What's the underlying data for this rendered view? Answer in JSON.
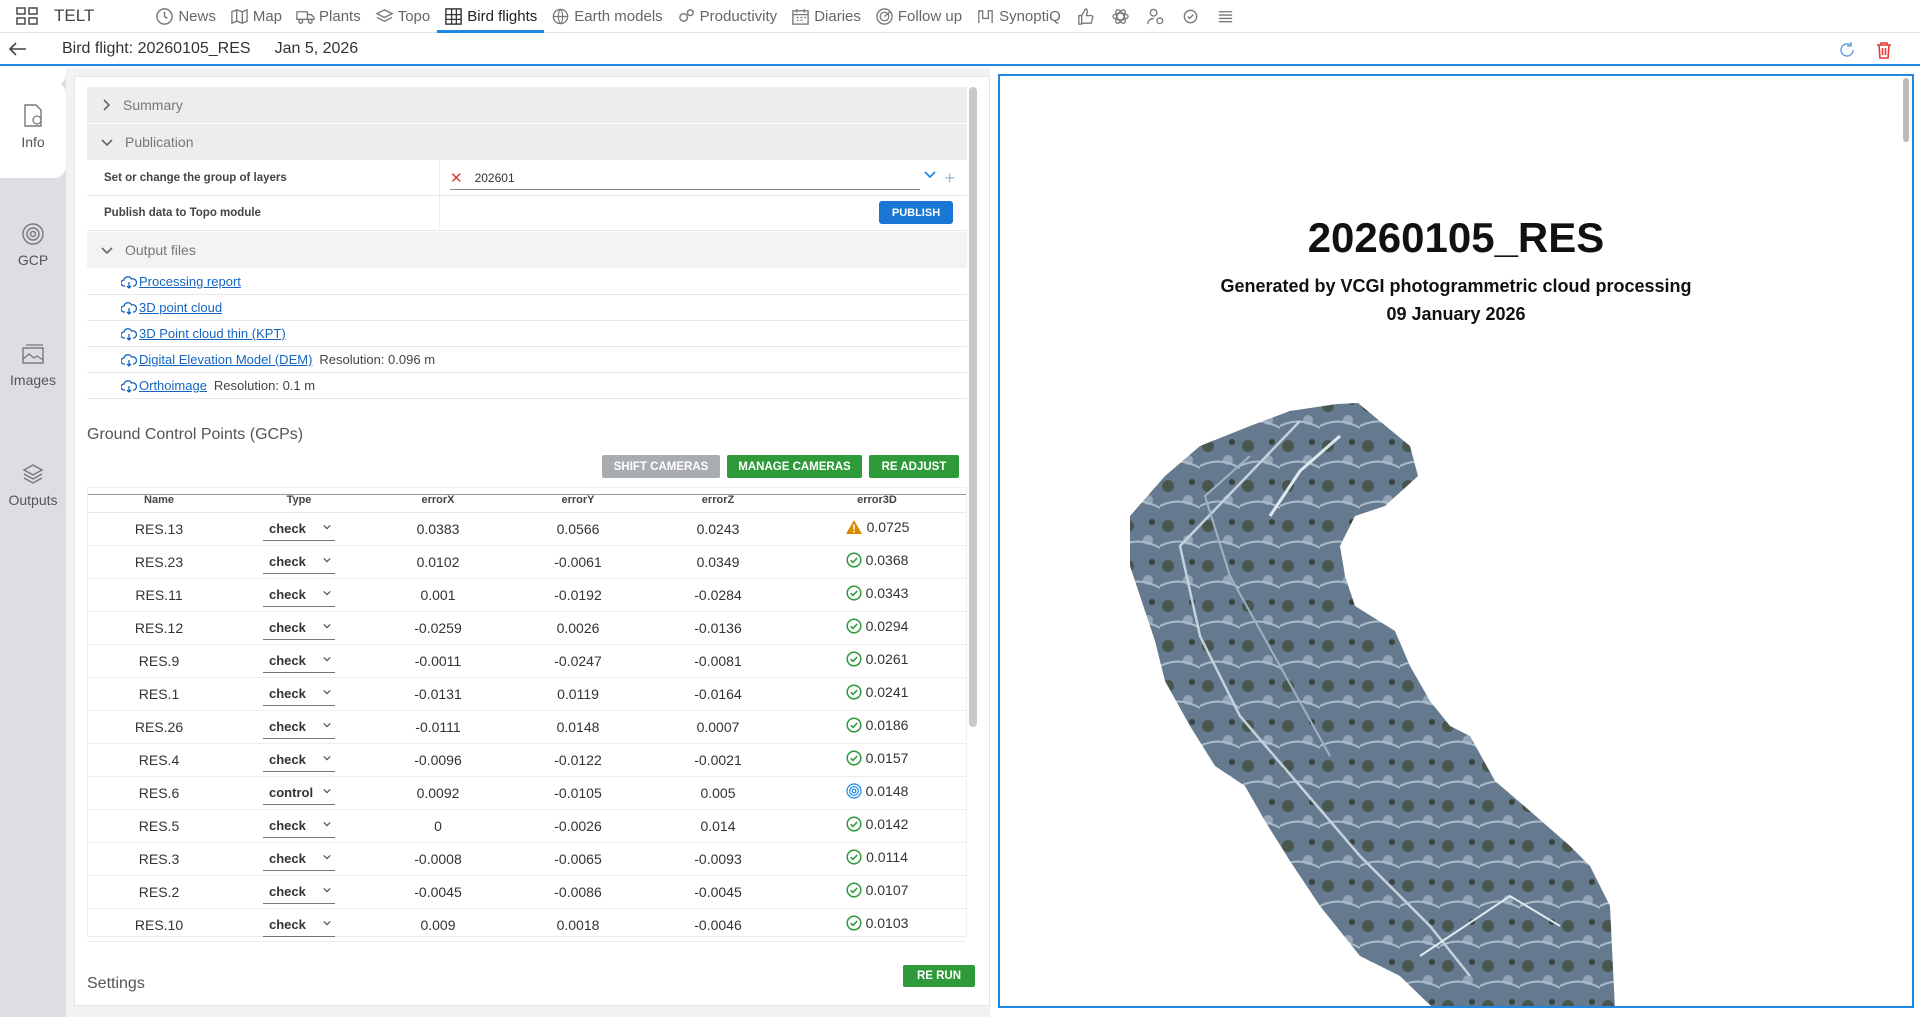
{
  "app": {
    "brand": "TELT"
  },
  "nav": [
    {
      "label": "News",
      "icon": "clock-icon"
    },
    {
      "label": "Map",
      "icon": "map-icon"
    },
    {
      "label": "Plants",
      "icon": "truck-icon"
    },
    {
      "label": "Topo",
      "icon": "layers-icon"
    },
    {
      "label": "Bird flights",
      "icon": "grid-icon",
      "active": true
    },
    {
      "label": "Earth models",
      "icon": "globe-icon"
    },
    {
      "label": "Productivity",
      "icon": "gears-icon"
    },
    {
      "label": "Diaries",
      "icon": "calendar-icon"
    },
    {
      "label": "Follow up",
      "icon": "radar-icon"
    },
    {
      "label": "SynoptiQ",
      "icon": "synoptiq-icon"
    }
  ],
  "header": {
    "title": "Bird flight: 20260105_RES",
    "date": "Jan 5, 2026"
  },
  "rail": [
    {
      "label": "Info",
      "icon": "info-doc-icon"
    },
    {
      "label": "GCP",
      "icon": "target-icon"
    },
    {
      "label": "Images",
      "icon": "images-icon"
    },
    {
      "label": "Outputs",
      "icon": "layers-icon"
    }
  ],
  "summary": {
    "label": "Summary"
  },
  "publication": {
    "label": "Publication",
    "group_label": "Set or change the group of layers",
    "group_value": "202601",
    "publish_label": "Publish data to Topo module",
    "publish_button": "PUBLISH"
  },
  "output_files": {
    "label": "Output files",
    "items": [
      {
        "name": "Processing report",
        "res": ""
      },
      {
        "name": "3D point cloud",
        "res": ""
      },
      {
        "name": "3D Point cloud thin (KPT)",
        "res": ""
      },
      {
        "name": "Digital Elevation Model (DEM)",
        "res": "Resolution: 0.096 m"
      },
      {
        "name": "Orthoimage",
        "res": "Resolution: 0.1 m"
      }
    ]
  },
  "gcp": {
    "title": "Ground Control Points (GCPs)",
    "buttons": {
      "shift": "SHIFT CAMERAS",
      "manage": "MANAGE CAMERAS",
      "readjust": "RE ADJUST"
    },
    "columns": [
      "Name",
      "Type",
      "errorX",
      "errorY",
      "errorZ",
      "error3D"
    ],
    "rows": [
      {
        "name": "RES.13",
        "type": "check",
        "ex": "0.0383",
        "ey": "0.0566",
        "ez": "0.0243",
        "e3d": "0.0725",
        "status": "warning"
      },
      {
        "name": "RES.23",
        "type": "check",
        "ex": "0.0102",
        "ey": "-0.0061",
        "ez": "0.0349",
        "e3d": "0.0368",
        "status": "ok"
      },
      {
        "name": "RES.11",
        "type": "check",
        "ex": "0.001",
        "ey": "-0.0192",
        "ez": "-0.0284",
        "e3d": "0.0343",
        "status": "ok"
      },
      {
        "name": "RES.12",
        "type": "check",
        "ex": "-0.0259",
        "ey": "0.0026",
        "ez": "-0.0136",
        "e3d": "0.0294",
        "status": "ok"
      },
      {
        "name": "RES.9",
        "type": "check",
        "ex": "-0.0011",
        "ey": "-0.0247",
        "ez": "-0.0081",
        "e3d": "0.0261",
        "status": "ok"
      },
      {
        "name": "RES.1",
        "type": "check",
        "ex": "-0.0131",
        "ey": "0.0119",
        "ez": "-0.0164",
        "e3d": "0.0241",
        "status": "ok"
      },
      {
        "name": "RES.26",
        "type": "check",
        "ex": "-0.0111",
        "ey": "0.0148",
        "ez": "0.0007",
        "e3d": "0.0186",
        "status": "ok"
      },
      {
        "name": "RES.4",
        "type": "check",
        "ex": "-0.0096",
        "ey": "-0.0122",
        "ez": "-0.0021",
        "e3d": "0.0157",
        "status": "ok"
      },
      {
        "name": "RES.6",
        "type": "control",
        "ex": "0.0092",
        "ey": "-0.0105",
        "ez": "0.005",
        "e3d": "0.0148",
        "status": "control"
      },
      {
        "name": "RES.5",
        "type": "check",
        "ex": "0",
        "ey": "-0.0026",
        "ez": "0.014",
        "e3d": "0.0142",
        "status": "ok"
      },
      {
        "name": "RES.3",
        "type": "check",
        "ex": "-0.0008",
        "ey": "-0.0065",
        "ez": "-0.0093",
        "e3d": "0.0114",
        "status": "ok"
      },
      {
        "name": "RES.2",
        "type": "check",
        "ex": "-0.0045",
        "ey": "-0.0086",
        "ez": "-0.0045",
        "e3d": "0.0107",
        "status": "ok"
      },
      {
        "name": "RES.10",
        "type": "check",
        "ex": "0.009",
        "ey": "0.0018",
        "ez": "-0.0046",
        "e3d": "0.0103",
        "status": "ok"
      }
    ]
  },
  "settings": {
    "label": "Settings",
    "rerun": "RE RUN"
  },
  "report": {
    "title": "20260105_RES",
    "subtitle": "Generated by VCGI photogrammetric cloud processing",
    "date": "09 January 2026"
  },
  "colors": {
    "accent": "#1e88e5",
    "green": "#2e9a3a",
    "warning": "#d98a00",
    "danger": "#e53935"
  }
}
